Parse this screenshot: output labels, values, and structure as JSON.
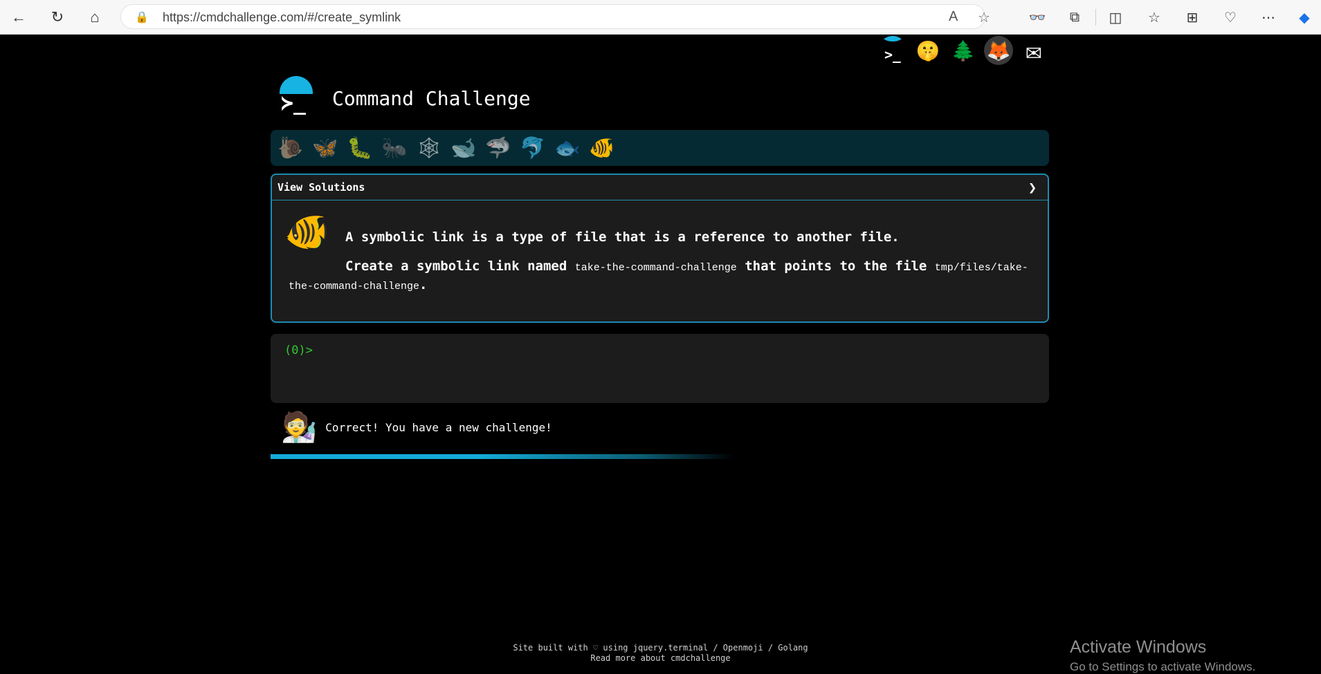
{
  "browser": {
    "url": "https://cmdchallenge.com/#/create_symlink",
    "buttons": {
      "back": "←",
      "refresh": "↻",
      "home": "⌂"
    },
    "icons": {
      "lock": "🔒",
      "read_aloud": "A",
      "favorite": "☆",
      "mask": "👓",
      "extensions": "⧉",
      "split": "◫",
      "favorites": "☆",
      "collections": "⊞",
      "health": "♡",
      "more": "⋯",
      "copilot": "◆"
    }
  },
  "header": {
    "title": "Command Challenge",
    "logo_prompt": "≻_",
    "social": {
      "terminal": ">_",
      "shush": "🤫",
      "tree": "🌲",
      "gitlab": "🦊",
      "mail": "✉"
    }
  },
  "levels": [
    "🐌",
    "🦋",
    "🐛",
    "🐜",
    "🕸",
    "🐋",
    "🦈",
    "🐬",
    "🐟",
    "🐠"
  ],
  "challenge": {
    "view_solutions": "View Solutions",
    "chevron": "❯",
    "icon": "🐠",
    "description1": "A symbolic link is a type of file that is a reference to another file.",
    "description2_pre": "Create a symbolic link named ",
    "link_name": "take-the-command-challenge",
    "description2_mid": " that points to the file ",
    "target": "tmp/files/take-the-command-challenge",
    "description2_end": "."
  },
  "terminal": {
    "prompt": "(0)>"
  },
  "feedback": {
    "mascot": "🧑‍🔬",
    "message": "Correct! You have a new challenge!"
  },
  "footer": {
    "line1": "Site built with ♡ using jquery.terminal / Openmoji / Golang",
    "line2": "Read more about cmdchallenge"
  },
  "watermark": {
    "title": "Activate Windows",
    "subtitle": "Go to Settings to activate Windows."
  }
}
